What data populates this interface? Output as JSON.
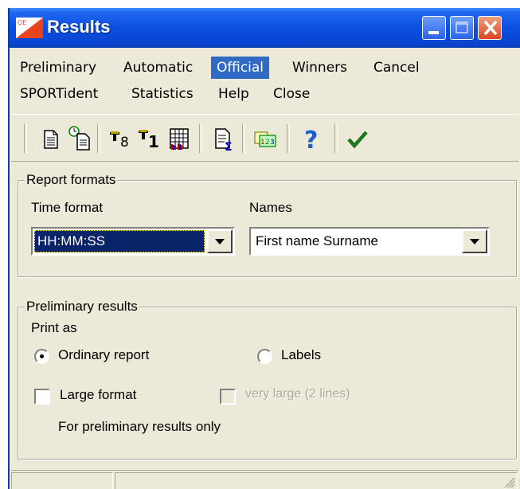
{
  "window": {
    "title": "Results"
  },
  "menu": {
    "row1": [
      "Preliminary",
      "Automatic",
      "Official",
      "Winners",
      "Cancel"
    ],
    "row2": [
      "SPORTident",
      "Statistics",
      "Help",
      "Close"
    ],
    "active": "Official"
  },
  "toolbar": {
    "icons": [
      "document-icon",
      "timed-document-icon",
      "trophy-8-icon",
      "trophy-1-icon",
      "grid-report-icon",
      "sum-report-icon",
      "number-123-icon",
      "help-icon",
      "ok-check-icon"
    ]
  },
  "report_formats": {
    "legend": "Report formats",
    "time_format": {
      "label": "Time format",
      "value": "HH:MM:SS"
    },
    "names": {
      "label": "Names",
      "value": "First name Surname"
    }
  },
  "preliminary_results": {
    "legend": "Preliminary results",
    "print_as_label": "Print as",
    "radio_ordinary": "Ordinary report",
    "radio_labels": "Labels",
    "selected_radio": "Ordinary report",
    "large_format": "Large format",
    "very_large": "very large (2 lines)",
    "note": "For preliminary results only"
  },
  "colors": {
    "title_bar": "#0b4fe0",
    "menu_highlight": "#316ac5",
    "dialog_bg": "#ece9d8"
  }
}
